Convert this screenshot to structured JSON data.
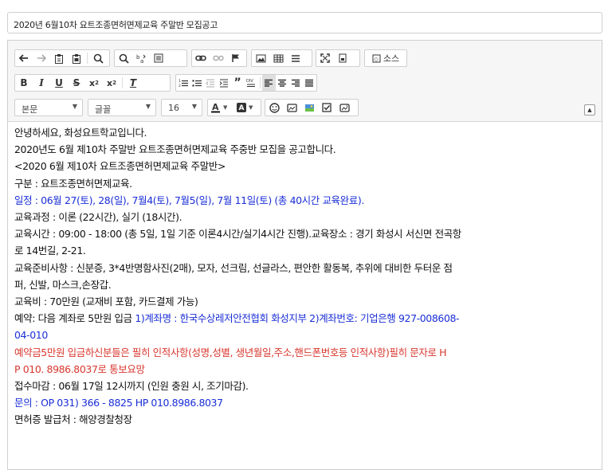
{
  "title_field": {
    "value": "2020년 6월10차 요트조종면허면제교육 주말반 모집공고"
  },
  "toolbar": {
    "source_label": "소스",
    "format_select": "본문",
    "font_select": "글꼴",
    "size_select": "16"
  },
  "content": {
    "l1": "안녕하세요, 화성요트학교입니다.",
    "l2": "2020년도 6월 제10차 주말반 요트조종면허면제교육 주중반 모집을 공고합니다.",
    "l3": "<2020 6월 제10차 요트조종면허면제교육 주말반>",
    "l4": "구분 : 요트조종면허면제교육.",
    "l5": "일정 : 06월 27(토), 28(일), 7월4(토), 7월5(일), 7월 11일(토) (총 40시간 교육완료).",
    "l6": "교육과정 : 이론 (22시간), 실기 (18시간).",
    "l7": "교육시간 : 09:00 - 18:00 (총 5일, 1일 기준 이론4시간/실기4시간 진행).교육장소 : 경기 화성시 서신면 전곡항",
    "l8": "로 14번길, 2-21.",
    "l9": "교육준비사항 : 신분증, 3*4반명함사진(2매), 모자, 선크림, 선글라스, 편안한 활동복, 추위에 대비한 두터운 점",
    "l10": "퍼, 신발, 마스크,손장갑.",
    "l11": "교육비 : 70만원 (교재비 포함, 카드결제 가능)",
    "l12a": "예약: 다음 계좌로 5만원 입금 ",
    "l12b": "1)계좌명 : 한국수상레저안전협회 화성지부 2)계좌번호: 기업은행 927-008608-",
    "l13": "04-010",
    "l14": "예약금5만원 입금하신분들은 필히 인적사항(성명,성별, 생년월일,주소,핸드폰번호등 인적사항)필히 문자로 H",
    "l15": "P 010. 8986.8037로 통보요망",
    "l16": "접수마감 : 06월 17일 12시까지 (인원 충원 시, 조기마감).",
    "l17": "문의 :  OP 031) 366 - 8825 HP 010.8986.8037",
    "l18": "면허증 발급처 : 해양경찰청장"
  }
}
